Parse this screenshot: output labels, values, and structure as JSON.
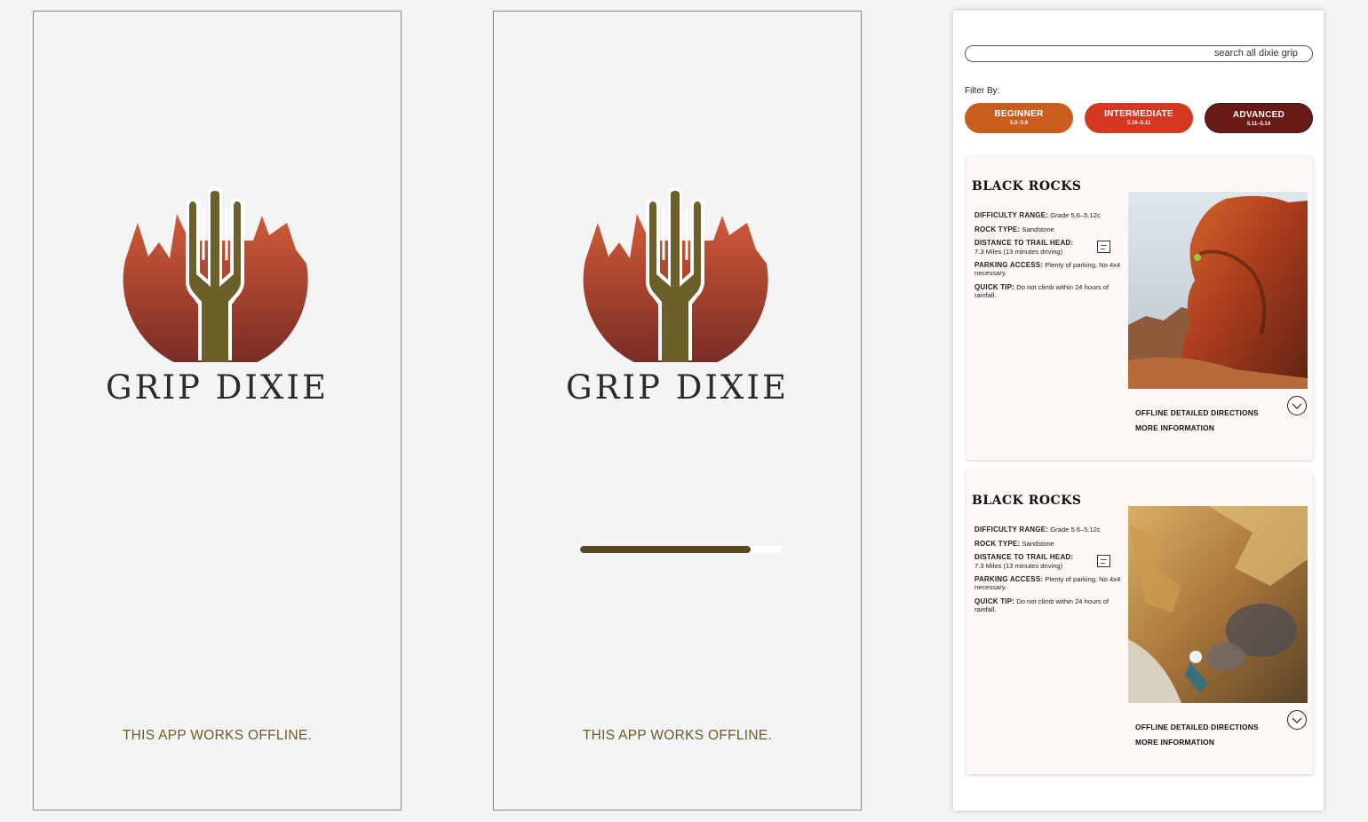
{
  "splash": {
    "brand": "GRIP DIXIE",
    "offline_note": "THIS APP WORKS OFFLINE."
  },
  "loading": {
    "brand": "GRIP DIXIE",
    "offline_note": "THIS APP WORKS OFFLINE.",
    "progress_fraction": 0.845
  },
  "browse": {
    "search_placeholder": "search all dixie grip",
    "filter_label": "Filter By:",
    "filters": [
      {
        "name": "BEGINNER",
        "range": "5.0–5.9",
        "color": "#c85d1d"
      },
      {
        "name": "INTERMEDIATE",
        "range": "5.10–5.11",
        "color": "#d43722"
      },
      {
        "name": "ADVANCED",
        "range": "5.11–5.14",
        "color": "#6b1915"
      }
    ],
    "cards": [
      {
        "title": "BLACK ROCKS",
        "difficulty_label": "DIFFICULTY RANGE:",
        "difficulty": "Grade 5.6–5.12c",
        "rock_label": "ROCK TYPE:",
        "rock": "Sandstone",
        "distance_label": "DISTANCE TO TRAIL HEAD:",
        "distance": "7.3 Miles (13 minutes driving)",
        "parking_label": "PARKING ACCESS:",
        "parking": "Plenty of parking, No 4x4 necessary.",
        "tip_label": "QUICK TIP:",
        "tip": "Do not climb within 24 hours of rainfall.",
        "directions": "OFFLINE DETAILED DIRECTIONS",
        "more": "MORE INFORMATION"
      },
      {
        "title": "BLACK ROCKS",
        "difficulty_label": "DIFFICULTY RANGE:",
        "difficulty": "Grade 5.6–5.12c",
        "rock_label": "ROCK TYPE:",
        "rock": "Sandstone",
        "distance_label": "DISTANCE TO TRAIL HEAD:",
        "distance": "7.3 Miles (13 minutes driving)",
        "parking_label": "PARKING ACCESS:",
        "parking": "Plenty of parking, No 4x4 necessary.",
        "tip_label": "QUICK TIP:",
        "tip": "Do not climb within 24 hours of rainfall.",
        "directions": "OFFLINE DETAILED DIRECTIONS",
        "more": "MORE INFORMATION"
      }
    ]
  },
  "colors": {
    "brand_olive": "#6b5f2a",
    "brand_red_top": "#c9553a",
    "brand_red_bottom": "#7a2d26"
  }
}
